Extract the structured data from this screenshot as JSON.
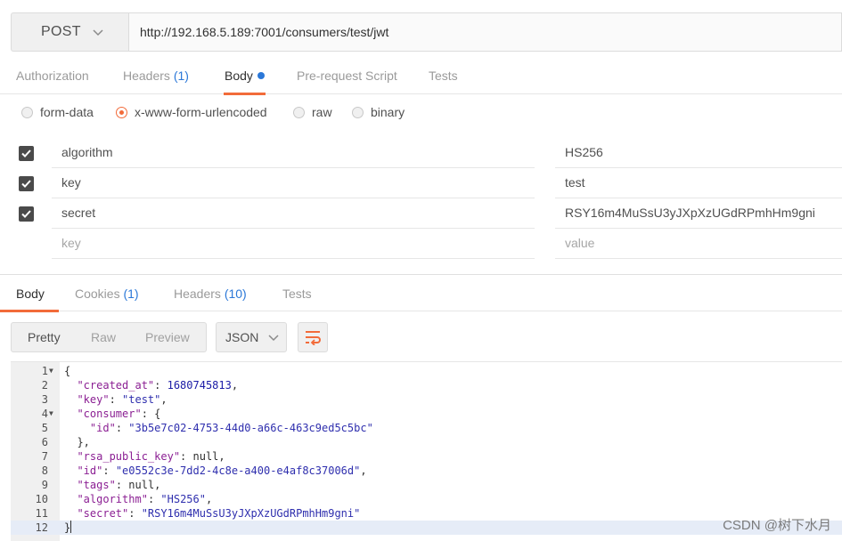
{
  "request": {
    "method": "POST",
    "url": "http://192.168.5.189:7001/consumers/test/jwt"
  },
  "request_tabs": [
    {
      "label": "Authorization",
      "count": ""
    },
    {
      "label": "Headers",
      "count": "(1)"
    },
    {
      "label": "Body",
      "count": ""
    },
    {
      "label": "Pre-request Script",
      "count": ""
    },
    {
      "label": "Tests",
      "count": ""
    }
  ],
  "body_types": [
    {
      "label": "form-data",
      "checked": false
    },
    {
      "label": "x-www-form-urlencoded",
      "checked": true
    },
    {
      "label": "raw",
      "checked": false
    },
    {
      "label": "binary",
      "checked": false
    }
  ],
  "params": [
    {
      "key": "algorithm",
      "value": "HS256",
      "checked": true
    },
    {
      "key": "key",
      "value": "test",
      "checked": true
    },
    {
      "key": "secret",
      "value": "RSY16m4MuSsU3yJXpXzUGdRPmhHm9gni",
      "checked": true
    }
  ],
  "params_placeholder": {
    "key": "key",
    "value": "value"
  },
  "response_tabs": [
    {
      "label": "Body",
      "count": ""
    },
    {
      "label": "Cookies",
      "count": "(1)"
    },
    {
      "label": "Headers",
      "count": "(10)"
    },
    {
      "label": "Tests",
      "count": ""
    }
  ],
  "view_modes": [
    "Pretty",
    "Raw",
    "Preview"
  ],
  "format": "JSON",
  "code_lines": [
    {
      "n": "1",
      "fold": true
    },
    {
      "n": "2",
      "fold": false
    },
    {
      "n": "3",
      "fold": false
    },
    {
      "n": "4",
      "fold": true
    },
    {
      "n": "5",
      "fold": false
    },
    {
      "n": "6",
      "fold": false
    },
    {
      "n": "7",
      "fold": false
    },
    {
      "n": "8",
      "fold": false
    },
    {
      "n": "9",
      "fold": false
    },
    {
      "n": "10",
      "fold": false
    },
    {
      "n": "11",
      "fold": false
    },
    {
      "n": "12",
      "fold": false
    }
  ],
  "json_body": {
    "created_at_key": "\"created_at\"",
    "created_at_val": "1680745813",
    "key_key": "\"key\"",
    "key_val": "\"test\"",
    "consumer_key": "\"consumer\"",
    "consumer_id_key": "\"id\"",
    "consumer_id_val": "\"3b5e7c02-4753-44d0-a66c-463c9ed5c5bc\"",
    "rsa_key": "\"rsa_public_key\"",
    "rsa_val": "null",
    "id_key": "\"id\"",
    "id_val": "\"e0552c3e-7dd2-4c8e-a400-e4af8c37006d\"",
    "tags_key": "\"tags\"",
    "tags_val": "null",
    "algorithm_key": "\"algorithm\"",
    "algorithm_val": "\"HS256\"",
    "secret_key": "\"secret\"",
    "secret_val": "\"RSY16m4MuSsU3yJXpXzUGdRPmhHm9gni\""
  },
  "watermark": "CSDN @树下水月",
  "colors": {
    "accent": "#f26b3a",
    "count_blue": "#2b78d8",
    "json_key": "#8b1f93",
    "json_string": "#2f2fae"
  }
}
